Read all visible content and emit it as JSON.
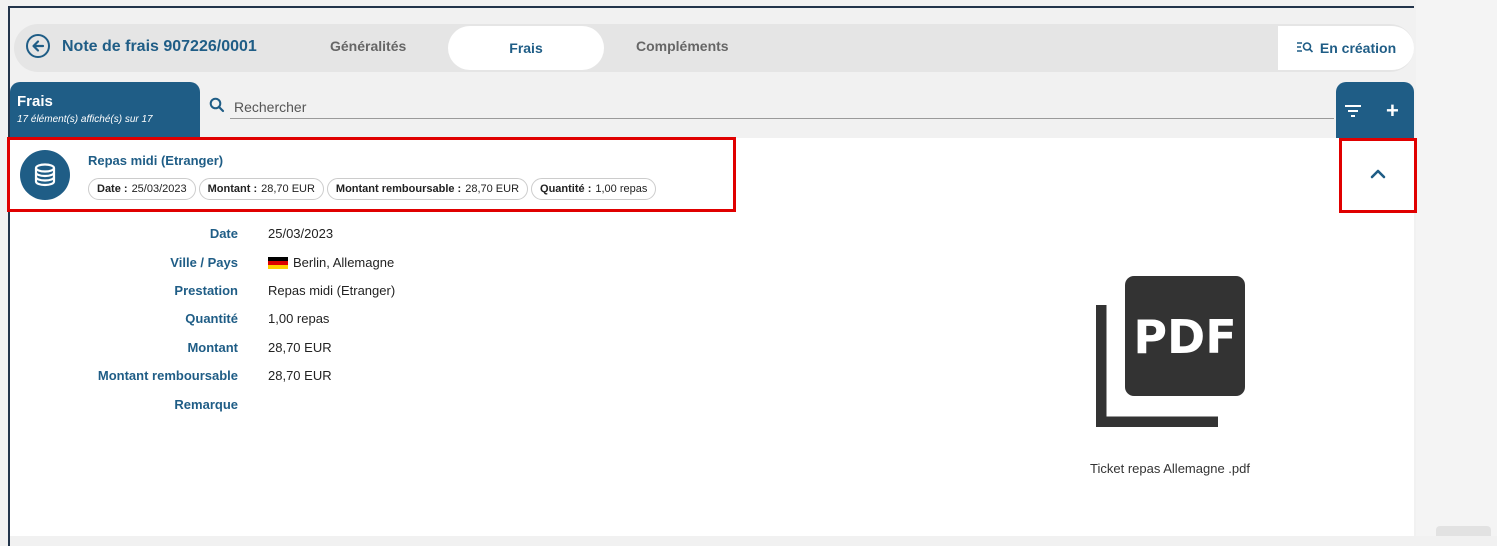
{
  "header": {
    "title": "Note de frais 907226/0001",
    "tabs": [
      {
        "label": "Généralités",
        "active": false
      },
      {
        "label": "Frais",
        "active": true
      },
      {
        "label": "Compléments",
        "active": false
      }
    ],
    "status_label": "En création",
    "status_icon": "list-search-icon"
  },
  "frais_panel": {
    "title": "Frais",
    "count_text": "17 élément(s) affiché(s) sur 17",
    "search_placeholder": "Rechercher",
    "add_symbol": "+"
  },
  "item": {
    "icon": "coins-icon",
    "title": "Repas midi (Etranger)",
    "chips": [
      {
        "label": "Date :",
        "value": "25/03/2023"
      },
      {
        "label": "Montant :",
        "value": "28,70 EUR"
      },
      {
        "label": "Montant remboursable :",
        "value": "28,70 EUR"
      },
      {
        "label": "Quantité :",
        "value": "1,00 repas"
      }
    ],
    "expanded": true
  },
  "details": [
    {
      "label": "Date",
      "value": "25/03/2023"
    },
    {
      "label": "Ville / Pays",
      "value": "Berlin, Allemagne",
      "flag": "de"
    },
    {
      "label": "Prestation",
      "value": "Repas midi (Etranger)"
    },
    {
      "label": "Quantité",
      "value": "1,00 repas"
    },
    {
      "label": "Montant",
      "value": "28,70 EUR"
    },
    {
      "label": "Montant remboursable",
      "value": "28,70 EUR"
    },
    {
      "label": "Remarque",
      "value": ""
    }
  ],
  "attachment": {
    "icon_text": "PDF",
    "filename": "Ticket repas Allemagne .pdf"
  },
  "colors": {
    "primary": "#1f5d86",
    "highlight": "#e00000",
    "pdf_icon": "#333333"
  }
}
